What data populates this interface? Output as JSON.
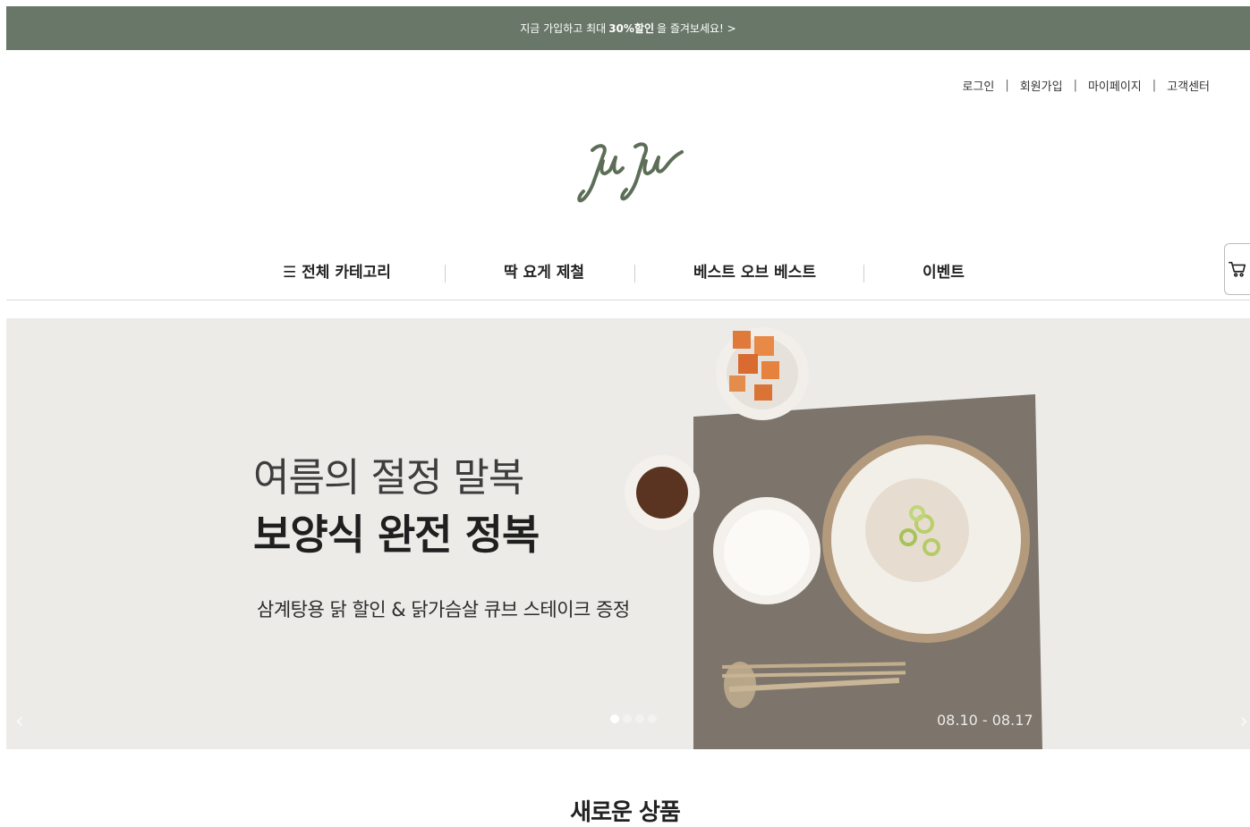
{
  "promo": {
    "pre": "지금 가입하고 최대",
    "bold": "30%할인",
    "post": "을 즐겨보세요! >"
  },
  "util_nav": [
    "로그인",
    "회원가입",
    "마이페이지",
    "고객센터"
  ],
  "util_sep": "|",
  "brand": {
    "logo_text": "JUJU"
  },
  "gnb": {
    "menu_icon": "☰",
    "items": [
      "전체 카테고리",
      "딱 요게 제철",
      "베스트 오브 베스트",
      "이벤트"
    ]
  },
  "cart_icon": "cart-icon",
  "hero": {
    "line1": "여름의 절정 말복",
    "line2": "보양식 완전 정복",
    "line3": "삼계탕용 닭 할인 & 닭가슴살 큐브 스테이크 증정",
    "date": "08.10 - 08.17",
    "prev": "‹",
    "next": "›",
    "active_slide": 1,
    "slide_count": 4
  },
  "section": {
    "title": "새로운 상품"
  },
  "colors": {
    "promo_bg": "#687767",
    "hero_bg": "#ecebe8",
    "logo": "#5d6e58"
  }
}
